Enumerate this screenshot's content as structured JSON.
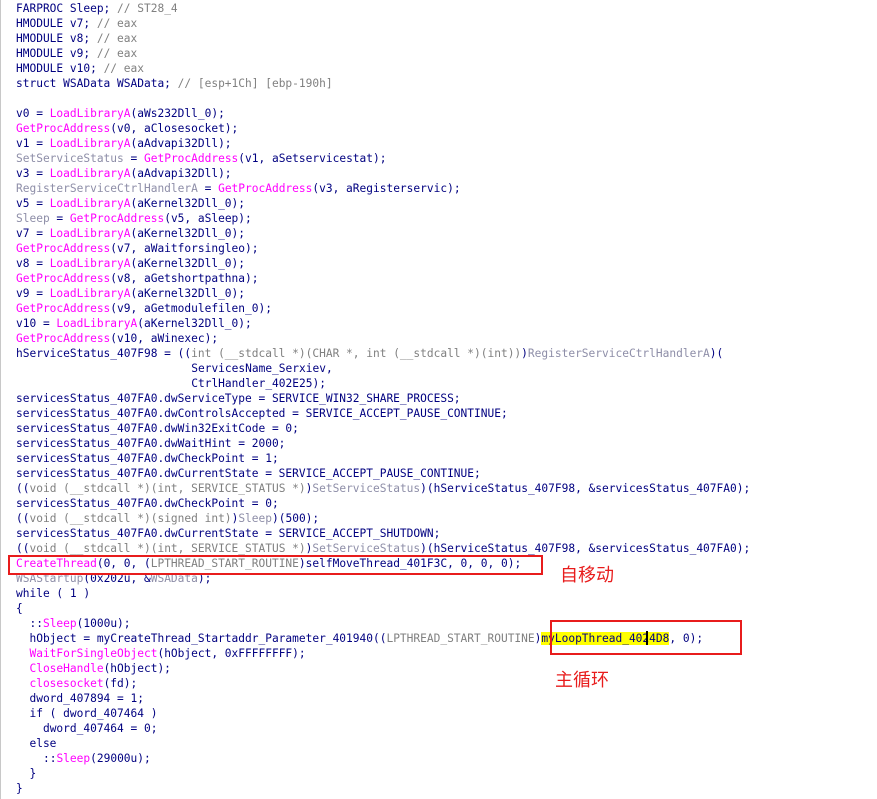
{
  "lines": [
    {
      "indent": 0,
      "tokens": [
        [
          "text",
          "FARPROC Sleep; "
        ],
        [
          "cmt",
          "// ST28_4"
        ]
      ]
    },
    {
      "indent": 0,
      "tokens": [
        [
          "text",
          "HMODULE v7; "
        ],
        [
          "cmt",
          "// eax"
        ]
      ]
    },
    {
      "indent": 0,
      "tokens": [
        [
          "text",
          "HMODULE v8; "
        ],
        [
          "cmt",
          "// eax"
        ]
      ]
    },
    {
      "indent": 0,
      "tokens": [
        [
          "text",
          "HMODULE v9; "
        ],
        [
          "cmt",
          "// eax"
        ]
      ]
    },
    {
      "indent": 0,
      "tokens": [
        [
          "text",
          "HMODULE v10; "
        ],
        [
          "cmt",
          "// eax"
        ]
      ]
    },
    {
      "indent": 0,
      "tokens": [
        [
          "text",
          "struct WSAData WSAData; "
        ],
        [
          "cmt",
          "// [esp+1Ch] [ebp-190h]"
        ]
      ]
    },
    {
      "indent": 0,
      "tokens": []
    },
    {
      "indent": 0,
      "tokens": [
        [
          "text",
          "v0 = "
        ],
        [
          "func",
          "LoadLibraryA"
        ],
        [
          "text",
          "(aWs232Dll_0);"
        ]
      ]
    },
    {
      "indent": 0,
      "tokens": [
        [
          "func",
          "GetProcAddress"
        ],
        [
          "text",
          "(v0, aClosesocket);"
        ]
      ]
    },
    {
      "indent": 0,
      "tokens": [
        [
          "text",
          "v1 = "
        ],
        [
          "func",
          "LoadLibraryA"
        ],
        [
          "text",
          "(aAdvapi32Dll);"
        ]
      ]
    },
    {
      "indent": 0,
      "tokens": [
        [
          "api",
          "SetServiceStatus"
        ],
        [
          "text",
          " = "
        ],
        [
          "func",
          "GetProcAddress"
        ],
        [
          "text",
          "(v1, aSetservicestat);"
        ]
      ]
    },
    {
      "indent": 0,
      "tokens": [
        [
          "text",
          "v3 = "
        ],
        [
          "func",
          "LoadLibraryA"
        ],
        [
          "text",
          "(aAdvapi32Dll);"
        ]
      ]
    },
    {
      "indent": 0,
      "tokens": [
        [
          "api",
          "RegisterServiceCtrlHandlerA"
        ],
        [
          "text",
          " = "
        ],
        [
          "func",
          "GetProcAddress"
        ],
        [
          "text",
          "(v3, aRegisterservic);"
        ]
      ]
    },
    {
      "indent": 0,
      "tokens": [
        [
          "text",
          "v5 = "
        ],
        [
          "func",
          "LoadLibraryA"
        ],
        [
          "text",
          "(aKernel32Dll_0);"
        ]
      ]
    },
    {
      "indent": 0,
      "tokens": [
        [
          "api",
          "Sleep"
        ],
        [
          "text",
          " = "
        ],
        [
          "func",
          "GetProcAddress"
        ],
        [
          "text",
          "(v5, aSleep);"
        ]
      ]
    },
    {
      "indent": 0,
      "tokens": [
        [
          "text",
          "v7 = "
        ],
        [
          "func",
          "LoadLibraryA"
        ],
        [
          "text",
          "(aKernel32Dll_0);"
        ]
      ]
    },
    {
      "indent": 0,
      "tokens": [
        [
          "func",
          "GetProcAddress"
        ],
        [
          "text",
          "(v7, aWaitforsingleo);"
        ]
      ]
    },
    {
      "indent": 0,
      "tokens": [
        [
          "text",
          "v8 = "
        ],
        [
          "func",
          "LoadLibraryA"
        ],
        [
          "text",
          "(aKernel32Dll_0);"
        ]
      ]
    },
    {
      "indent": 0,
      "tokens": [
        [
          "func",
          "GetProcAddress"
        ],
        [
          "text",
          "(v8, aGetshortpathna);"
        ]
      ]
    },
    {
      "indent": 0,
      "tokens": [
        [
          "text",
          "v9 = "
        ],
        [
          "func",
          "LoadLibraryA"
        ],
        [
          "text",
          "(aKernel32Dll_0);"
        ]
      ]
    },
    {
      "indent": 0,
      "tokens": [
        [
          "func",
          "GetProcAddress"
        ],
        [
          "text",
          "(v9, aGetmodulefilen_0);"
        ]
      ]
    },
    {
      "indent": 0,
      "tokens": [
        [
          "text",
          "v10 = "
        ],
        [
          "func",
          "LoadLibraryA"
        ],
        [
          "text",
          "(aKernel32Dll_0);"
        ]
      ]
    },
    {
      "indent": 0,
      "tokens": [
        [
          "func",
          "GetProcAddress"
        ],
        [
          "text",
          "(v10, aWinexec);"
        ]
      ]
    },
    {
      "indent": 0,
      "tokens": [
        [
          "text",
          "hServiceStatus_407F98 = (("
        ],
        [
          "cast",
          "int (__stdcall *)(CHAR *, int (__stdcall *)(int))"
        ],
        [
          "text",
          ")"
        ],
        [
          "api",
          "RegisterServiceCtrlHandlerA"
        ],
        [
          "text",
          ")("
        ]
      ]
    },
    {
      "indent": 26,
      "tokens": [
        [
          "text",
          "ServicesName_Serxiev,"
        ]
      ]
    },
    {
      "indent": 26,
      "tokens": [
        [
          "text",
          "CtrlHandler_402E25);"
        ]
      ]
    },
    {
      "indent": 0,
      "tokens": [
        [
          "text",
          "servicesStatus_407FA0.dwServiceType = SERVICE_WIN32_SHARE_PROCESS;"
        ]
      ]
    },
    {
      "indent": 0,
      "tokens": [
        [
          "text",
          "servicesStatus_407FA0.dwControlsAccepted = SERVICE_ACCEPT_PAUSE_CONTINUE;"
        ]
      ]
    },
    {
      "indent": 0,
      "tokens": [
        [
          "text",
          "servicesStatus_407FA0.dwWin32ExitCode = 0;"
        ]
      ]
    },
    {
      "indent": 0,
      "tokens": [
        [
          "text",
          "servicesStatus_407FA0.dwWaitHint = 2000;"
        ]
      ]
    },
    {
      "indent": 0,
      "tokens": [
        [
          "text",
          "servicesStatus_407FA0.dwCheckPoint = 1;"
        ]
      ]
    },
    {
      "indent": 0,
      "tokens": [
        [
          "text",
          "servicesStatus_407FA0.dwCurrentState = SERVICE_ACCEPT_PAUSE_CONTINUE;"
        ]
      ]
    },
    {
      "indent": 0,
      "tokens": [
        [
          "text",
          "(("
        ],
        [
          "cast",
          "void (__stdcall *)(int, SERVICE_STATUS *)"
        ],
        [
          "text",
          ")"
        ],
        [
          "api",
          "SetServiceStatus"
        ],
        [
          "text",
          ")(hServiceStatus_407F98, &servicesStatus_407FA0);"
        ]
      ]
    },
    {
      "indent": 0,
      "tokens": [
        [
          "text",
          "servicesStatus_407FA0.dwCheckPoint = 0;"
        ]
      ]
    },
    {
      "indent": 0,
      "tokens": [
        [
          "text",
          "(("
        ],
        [
          "cast",
          "void (__stdcall *)(signed int)"
        ],
        [
          "text",
          ")"
        ],
        [
          "api",
          "Sleep"
        ],
        [
          "text",
          ")(500);"
        ]
      ]
    },
    {
      "indent": 0,
      "tokens": [
        [
          "text",
          "servicesStatus_407FA0.dwCurrentState = SERVICE_ACCEPT_SHUTDOWN;"
        ]
      ]
    },
    {
      "indent": 0,
      "tokens": [
        [
          "text",
          "(("
        ],
        [
          "cast",
          "void (__stdcall *)(int, SERVICE_STATUS *)"
        ],
        [
          "text",
          ")"
        ],
        [
          "api",
          "SetServiceStatus"
        ],
        [
          "text",
          ")(hServiceStatus_407F98, &servicesStatus_407FA0);"
        ]
      ]
    },
    {
      "indent": 0,
      "tokens": [
        [
          "func",
          "CreateThread"
        ],
        [
          "text",
          "(0, 0, ("
        ],
        [
          "cast",
          "LPTHREAD_START_ROUTINE"
        ],
        [
          "text",
          ")selfMoveThread_401F3C, 0, 0, 0);"
        ]
      ]
    },
    {
      "indent": 0,
      "tokens": [
        [
          "api",
          "WSAStartup"
        ],
        [
          "text",
          "(0x202u, &"
        ],
        [
          "api",
          "WSAData"
        ],
        [
          "text",
          ");"
        ]
      ]
    },
    {
      "indent": 0,
      "tokens": [
        [
          "text",
          "while ( 1 )"
        ]
      ]
    },
    {
      "indent": 0,
      "tokens": [
        [
          "text",
          "{"
        ]
      ]
    },
    {
      "indent": 2,
      "tokens": [
        [
          "text",
          "::"
        ],
        [
          "func",
          "Sleep"
        ],
        [
          "text",
          "(1000u);"
        ]
      ]
    },
    {
      "indent": 2,
      "tokens": [
        [
          "text",
          "hObject = myCreateThread_Startaddr_Parameter_401940(("
        ],
        [
          "cast",
          "LPTHREAD_START_ROUTINE"
        ],
        [
          "text",
          ")"
        ],
        [
          "hl",
          "myLoopThread_4024D8"
        ],
        [
          "text",
          ", 0);"
        ]
      ]
    },
    {
      "indent": 2,
      "tokens": [
        [
          "func",
          "WaitForSingleObject"
        ],
        [
          "text",
          "(hObject, 0xFFFFFFFF);"
        ]
      ]
    },
    {
      "indent": 2,
      "tokens": [
        [
          "func",
          "CloseHandle"
        ],
        [
          "text",
          "(hObject);"
        ]
      ]
    },
    {
      "indent": 2,
      "tokens": [
        [
          "func",
          "closesocket"
        ],
        [
          "text",
          "(fd);"
        ]
      ]
    },
    {
      "indent": 2,
      "tokens": [
        [
          "text",
          "dword_407894 = 1;"
        ]
      ]
    },
    {
      "indent": 2,
      "tokens": [
        [
          "text",
          "if ( dword_407464 )"
        ]
      ]
    },
    {
      "indent": 4,
      "tokens": [
        [
          "text",
          "dword_407464 = 0;"
        ]
      ]
    },
    {
      "indent": 2,
      "tokens": [
        [
          "text",
          "else"
        ]
      ]
    },
    {
      "indent": 4,
      "tokens": [
        [
          "text",
          "::"
        ],
        [
          "func",
          "Sleep"
        ],
        [
          "text",
          "(29000u);"
        ]
      ]
    },
    {
      "indent": 2,
      "tokens": [
        [
          "text",
          "}"
        ]
      ]
    },
    {
      "indent": 0,
      "tokens": [
        [
          "text",
          "}"
        ]
      ]
    }
  ],
  "annotations": {
    "self_move": "自移动",
    "main_loop": "主循环"
  },
  "colors": {
    "background": "#ffffff",
    "code_text": "#000080",
    "comment": "#808080",
    "function_call": "#ff00ff",
    "api_pointer": "#8e8ea8",
    "highlight": "#ffff00",
    "annotation_red": "#e81c1c"
  }
}
